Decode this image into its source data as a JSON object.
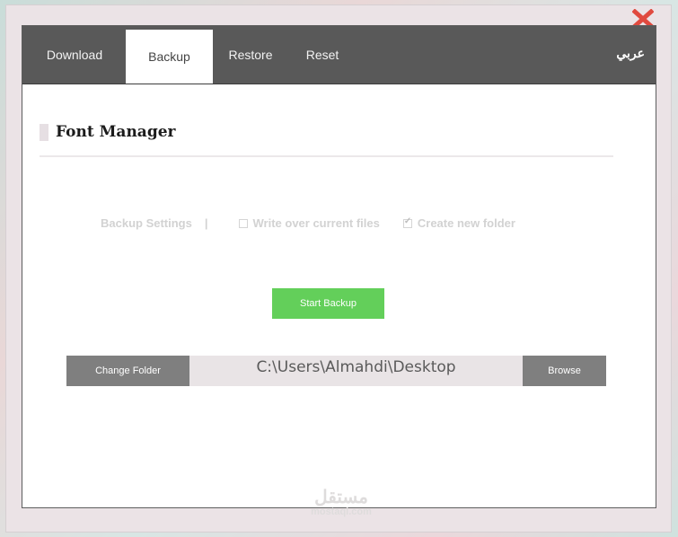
{
  "tabs": [
    {
      "label": "Download",
      "active": false
    },
    {
      "label": "Backup",
      "active": true
    },
    {
      "label": "Restore",
      "active": false
    },
    {
      "label": "Reset",
      "active": false
    }
  ],
  "language_label": "عربي",
  "page_title": "Font Manager",
  "backup_settings": {
    "label": "Backup Settings",
    "separator": "|",
    "write_over_label": "Write over current files",
    "write_over_checked": false,
    "create_folder_label": "Create new folder",
    "create_folder_checked": true
  },
  "start_button_label": "Start Backup",
  "folder": {
    "change_label": "Change Folder",
    "path": "C:\\Users\\Almahdi\\Desktop",
    "browse_label": "Browse"
  },
  "watermark": {
    "arabic": "مستقل",
    "latin": "mostaql.com"
  },
  "colors": {
    "tabbar": "#595959",
    "start_button": "#63cf5a",
    "grey_button": "#7f7f7f",
    "close_icon": "#e04a3f"
  },
  "icons": {
    "close": "close-icon"
  }
}
